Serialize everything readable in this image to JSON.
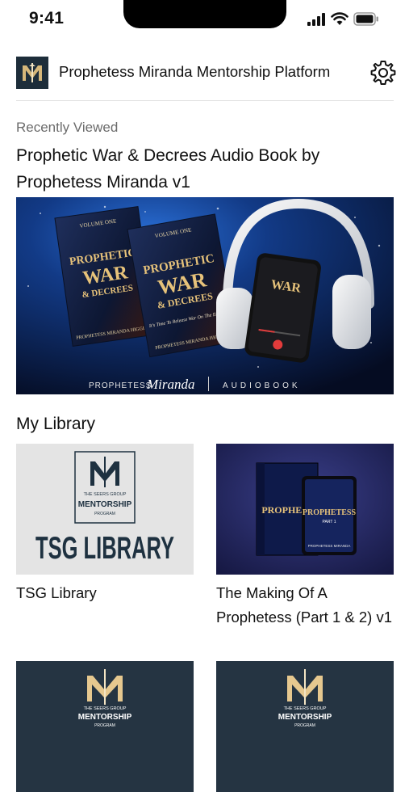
{
  "status": {
    "time": "9:41"
  },
  "header": {
    "title": "Prophetess Miranda Mentorship Platform",
    "logo_text": "M"
  },
  "recent": {
    "label": "Recently Viewed",
    "title": "Prophetic War & Decrees Audio Book by Prophetess Miranda v1",
    "banner": {
      "volume": "VOLUME ONE",
      "book_title_1": "PROPHETIC",
      "book_title_2": "WAR",
      "book_title_3": "& DECREES",
      "book_subtitle": "It's Time To Release War On The Enemy!",
      "book_author": "PROPHETESS MIRANDA HIGGINS",
      "footer_left": "PROPHETESS",
      "footer_script": "Miranda",
      "footer_right": "AUDIOBOOK"
    }
  },
  "library": {
    "label": "My Library",
    "items": [
      {
        "title": "TSG Library",
        "brand_top": "THE SEERS GROUP",
        "brand_main": "MENTORSHIP",
        "brand_sub": "PROGRAM",
        "big": "TSG LIBRARY"
      },
      {
        "title": "The Making Of A Prophetess (Part 1 & 2) v1",
        "book_title": "PROPHETESS",
        "book_part": "PART 1",
        "book_author": "PROPHETESS MIRANDA"
      },
      {
        "title": "",
        "brand_top": "THE SEERS GROUP",
        "brand_main": "MENTORSHIP",
        "brand_sub": "PROGRAM"
      },
      {
        "title": "",
        "brand_top": "THE SEERS GROUP",
        "brand_main": "MENTORSHIP",
        "brand_sub": "PROGRAM"
      }
    ]
  }
}
